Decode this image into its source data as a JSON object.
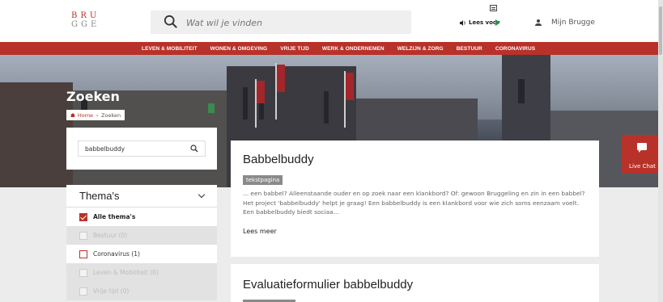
{
  "header": {
    "logo_line1": "BRU",
    "logo_line2": "GGE",
    "search_placeholder": "Wat wil je vinden",
    "lees_voor": "Lees voor",
    "user_label": "Mijn Brugge"
  },
  "nav": {
    "items": [
      "LEVEN & MOBILITEIT",
      "WONEN & OMGEVING",
      "VRIJE TIJD",
      "WERK & ONDERNEMEN",
      "WELZIJN & ZORG",
      "BESTUUR",
      "CORONAVIRUS"
    ]
  },
  "hero": {
    "title": "Zoeken",
    "breadcrumb_home": "Home",
    "breadcrumb_sep": "»",
    "breadcrumb_current": "Zoeken"
  },
  "sidebar": {
    "search_value": "babbelbuddy",
    "facet_title": "Thema's",
    "items": [
      {
        "label": "Alle thema's"
      },
      {
        "label": "Bestuur (0)"
      },
      {
        "label": "Coronavirus (1)"
      },
      {
        "label": "Leven & Mobiliteit (0)"
      },
      {
        "label": "Vrije tijd (0)"
      }
    ]
  },
  "results": [
    {
      "title": "Babbelbuddy",
      "tag": "tekstpagina",
      "excerpt": "... een babbel? Alleenstaande ouder en op zoek naar een klankbord? Of: gewoon Bruggeling en zin in een babbel? Het project 'babbelbuddy' helpt je graag! Een babbelbuddy is een klankbord voor wie zich soms eenzaam voelt. Een babbelbuddy biedt sociaa...",
      "more": "Lees meer"
    },
    {
      "title": "Evaluatieformulier babbelbuddy",
      "tag": ""
    }
  ],
  "livechat": {
    "label": "Live Chat"
  },
  "colors": {
    "brand": "#b8322a"
  }
}
